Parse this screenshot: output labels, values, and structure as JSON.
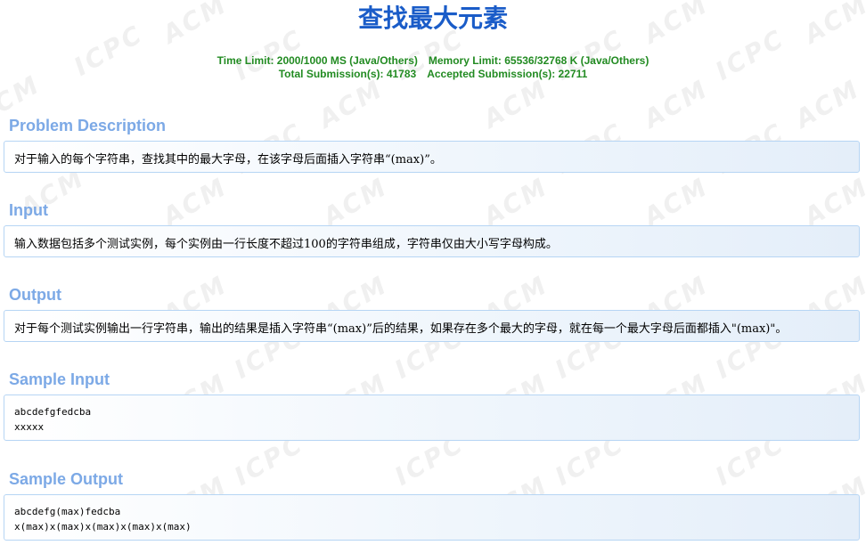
{
  "problem": {
    "title": "查找最大元素",
    "limits": {
      "time_limit": "Time Limit: 2000/1000 MS (Java/Others)",
      "memory_limit": "Memory Limit: 65536/32768 K (Java/Others)",
      "total_submissions": "Total Submission(s): 41783",
      "accepted_submissions": "Accepted Submission(s): 22711"
    },
    "sections": {
      "description": {
        "heading": "Problem Description",
        "body": "对于输入的每个字符串，查找其中的最大字母，在该字母后面插入字符串“(max)”。"
      },
      "input": {
        "heading": "Input",
        "body": "输入数据包括多个测试实例，每个实例由一行长度不超过100的字符串组成，字符串仅由大小写字母构成。"
      },
      "output": {
        "heading": "Output",
        "body": "对于每个测试实例输出一行字符串，输出的结果是插入字符串“(max)”后的结果，如果存在多个最大的字母，就在每一个最大字母后面都插入\"(max)\"。"
      },
      "sample_input": {
        "heading": "Sample Input",
        "lines": [
          "abcdefgfedcba",
          "xxxxx"
        ]
      },
      "sample_output": {
        "heading": "Sample Output",
        "lines": [
          "abcdefg(max)fedcba",
          "x(max)x(max)x(max)x(max)x(max)"
        ]
      }
    }
  },
  "watermark": {
    "texts": [
      "ACM",
      "ICPC"
    ]
  }
}
